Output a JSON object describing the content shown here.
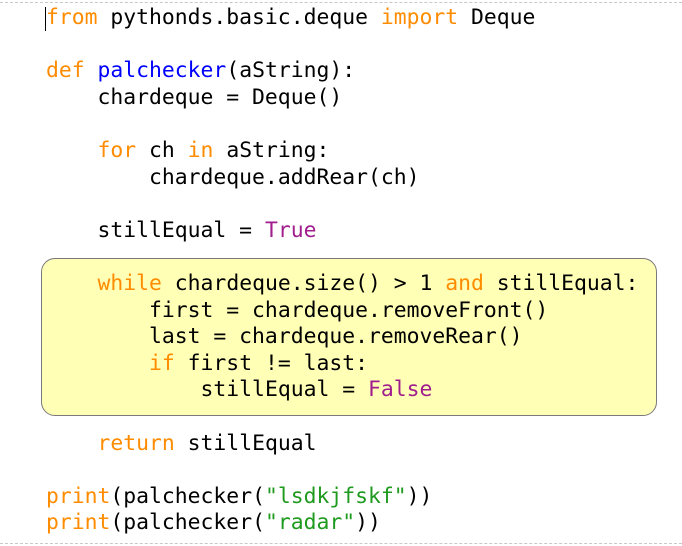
{
  "colors": {
    "keyword": "#ff8c00",
    "function_name": "#0000ff",
    "boolean": "#a01d8e",
    "string": "#1e9a1e",
    "text": "#000000",
    "highlight_background": "#ffffb6",
    "highlight_border": "#7a7a7a"
  },
  "code": {
    "lines": [
      {
        "indent": "",
        "tokens": [
          {
            "t": "from",
            "c": "kw"
          },
          {
            "t": " pythonds.basic.deque ",
            "c": "plain"
          },
          {
            "t": "import",
            "c": "kw"
          },
          {
            "t": " Deque",
            "c": "plain"
          }
        ]
      },
      {
        "indent": "",
        "tokens": []
      },
      {
        "indent": "",
        "tokens": [
          {
            "t": "def",
            "c": "kw"
          },
          {
            "t": " ",
            "c": "plain"
          },
          {
            "t": "palchecker",
            "c": "fn"
          },
          {
            "t": "(aString):",
            "c": "plain"
          }
        ]
      },
      {
        "indent": "    ",
        "tokens": [
          {
            "t": "chardeque = Deque()",
            "c": "plain"
          }
        ]
      },
      {
        "indent": "",
        "tokens": []
      },
      {
        "indent": "    ",
        "tokens": [
          {
            "t": "for",
            "c": "kw"
          },
          {
            "t": " ch ",
            "c": "plain"
          },
          {
            "t": "in",
            "c": "kw"
          },
          {
            "t": " aString:",
            "c": "plain"
          }
        ]
      },
      {
        "indent": "        ",
        "tokens": [
          {
            "t": "chardeque.addRear(ch)",
            "c": "plain"
          }
        ]
      },
      {
        "indent": "",
        "tokens": []
      },
      {
        "indent": "    ",
        "tokens": [
          {
            "t": "stillEqual = ",
            "c": "plain"
          },
          {
            "t": "True",
            "c": "bool"
          }
        ]
      },
      {
        "indent": "",
        "tokens": []
      },
      {
        "indent": "    ",
        "tokens": [
          {
            "t": "while",
            "c": "kw"
          },
          {
            "t": " chardeque.size() > 1 ",
            "c": "plain"
          },
          {
            "t": "and",
            "c": "kw"
          },
          {
            "t": " stillEqual:",
            "c": "plain"
          }
        ]
      },
      {
        "indent": "        ",
        "tokens": [
          {
            "t": "first = chardeque.removeFront()",
            "c": "plain"
          }
        ]
      },
      {
        "indent": "        ",
        "tokens": [
          {
            "t": "last = chardeque.removeRear()",
            "c": "plain"
          }
        ]
      },
      {
        "indent": "        ",
        "tokens": [
          {
            "t": "if",
            "c": "kw"
          },
          {
            "t": " first != last:",
            "c": "plain"
          }
        ]
      },
      {
        "indent": "            ",
        "tokens": [
          {
            "t": "stillEqual = ",
            "c": "plain"
          },
          {
            "t": "False",
            "c": "bool"
          }
        ]
      },
      {
        "indent": "",
        "tokens": []
      },
      {
        "indent": "    ",
        "tokens": [
          {
            "t": "return",
            "c": "kw"
          },
          {
            "t": " stillEqual",
            "c": "plain"
          }
        ]
      },
      {
        "indent": "",
        "tokens": []
      },
      {
        "indent": "",
        "tokens": [
          {
            "t": "print",
            "c": "kw"
          },
          {
            "t": "(palchecker(",
            "c": "plain"
          },
          {
            "t": "\"lsdkjfskf\"",
            "c": "str"
          },
          {
            "t": "))",
            "c": "plain"
          }
        ]
      },
      {
        "indent": "",
        "tokens": [
          {
            "t": "print",
            "c": "kw"
          },
          {
            "t": "(palchecker(",
            "c": "plain"
          },
          {
            "t": "\"radar\"",
            "c": "str"
          },
          {
            "t": "))",
            "c": "plain"
          }
        ]
      }
    ]
  }
}
